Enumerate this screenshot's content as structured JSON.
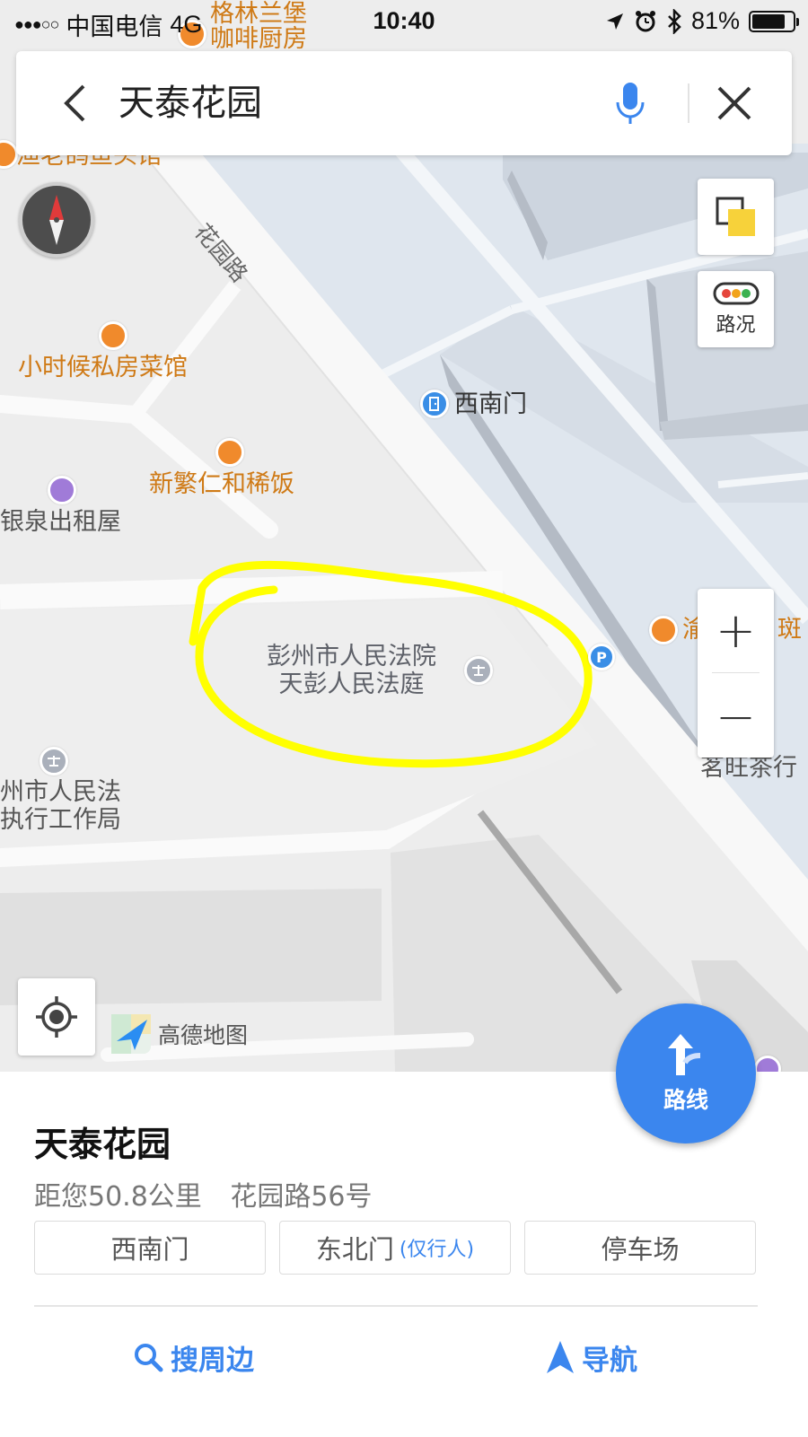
{
  "status_bar": {
    "signal": "●●●○○",
    "carrier": "中国电信",
    "network": "4G",
    "time": "10:40",
    "battery_percent": "81%",
    "battery_level": 0.81,
    "icons": [
      "location-arrow-icon",
      "alarm-icon",
      "bluetooth-icon",
      "battery-icon"
    ]
  },
  "search": {
    "query": "天泰花园",
    "icons": [
      "back-icon",
      "microphone-icon",
      "close-icon"
    ]
  },
  "map": {
    "road_label": "花园路",
    "pois": [
      {
        "name": "格林兰堡\n咖啡厨房",
        "color": "orange"
      },
      {
        "name": "渔老鸽鱼头馆",
        "color": "orange"
      },
      {
        "name": "小时候私房菜馆",
        "color": "orange"
      },
      {
        "name": "新繁仁和稀饭",
        "color": "orange"
      },
      {
        "name": "银泉出租屋",
        "color": "gray"
      },
      {
        "name": "西南门",
        "color": "dark"
      },
      {
        "name": "彭州市人民法院\n天彭人民法庭",
        "color": "gray"
      },
      {
        "name": "州市人民法\n执行工作局",
        "color": "gray"
      },
      {
        "name": "渝",
        "color": "orange"
      },
      {
        "name": "斑",
        "color": "orange"
      },
      {
        "name": "茗旺茶行",
        "color": "gray"
      }
    ],
    "traffic_label": "路况",
    "zoom_in": "+",
    "zoom_out": "−",
    "logo_text": "高德地图",
    "route_label": "路线",
    "highlight_color": "#ffff00"
  },
  "panel": {
    "title": "天泰花园",
    "distance": "距您50.8公里",
    "address": "花园路56号",
    "entrances": [
      {
        "label": "西南门",
        "note": ""
      },
      {
        "label": "东北门",
        "note": "(仅行人)"
      },
      {
        "label": "停车场",
        "note": ""
      }
    ],
    "actions": {
      "search_nearby": "搜周边",
      "navigate": "导航"
    }
  },
  "colors": {
    "accent": "#3b86ee",
    "poi_orange": "#cf7a16",
    "highlight": "#ffff00"
  }
}
